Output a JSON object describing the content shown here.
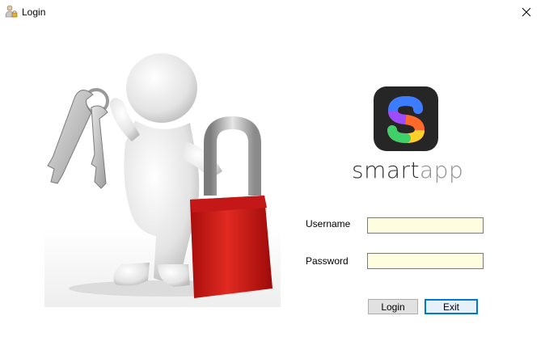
{
  "window": {
    "title": "Login",
    "icon": "user-lock-icon",
    "close_icon": "close-icon"
  },
  "hero": {
    "image": "character-with-keys-and-padlock",
    "padlock_color": "#d32020"
  },
  "logo": {
    "icon": "smartapp-s-logo",
    "word_primary": "smart",
    "word_secondary": "app",
    "tile_color": "#262626"
  },
  "form": {
    "username_label": "Username",
    "username_value": "",
    "password_label": "Password",
    "password_value": "",
    "field_color": "#fffde0"
  },
  "buttons": {
    "login_label": "Login",
    "exit_label": "Exit",
    "focus_color": "#0078d7"
  }
}
